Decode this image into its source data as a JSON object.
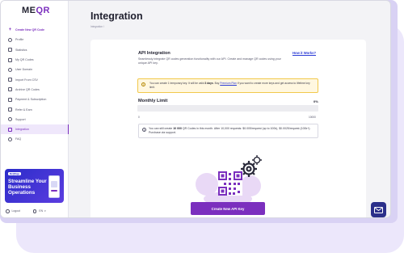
{
  "app": {
    "logo_text_a": "ME",
    "logo_text_b": "QR"
  },
  "sidebar": {
    "items": [
      {
        "label": "Create New QR Code",
        "icon": "plus-icon"
      },
      {
        "label": "Profile",
        "icon": "user-icon"
      },
      {
        "label": "Statistics",
        "icon": "chart-icon"
      },
      {
        "label": "My QR Codes",
        "icon": "qr-icon"
      },
      {
        "label": "User Domain",
        "icon": "globe-icon"
      },
      {
        "label": "Import From CSV",
        "icon": "upload-icon"
      },
      {
        "label": "Archive QR Codes",
        "icon": "archive-icon"
      },
      {
        "label": "Payment & Subscription",
        "icon": "card-icon"
      },
      {
        "label": "Refer & Earn",
        "icon": "gift-icon"
      },
      {
        "label": "Support",
        "icon": "headset-icon"
      },
      {
        "label": "Integration",
        "icon": "link-icon"
      },
      {
        "label": "FAQ",
        "icon": "help-icon"
      }
    ],
    "active": "Integration",
    "promo": {
      "badge": "MeQRapp",
      "text": "Streamline Your Business Operations"
    },
    "footer": {
      "logout": "Logout",
      "language": "EN"
    }
  },
  "page": {
    "title": "Integration",
    "breadcrumb": "Integration /"
  },
  "api": {
    "title": "API Integration",
    "how_link": "How it Works?",
    "description": "Seamlessly integrate QR codes generation functionality with our API. Create and manage QR codes using your unique API key."
  },
  "notice": {
    "prefix": "You can create 1 temporary key. It will be valid ",
    "days": "3 days",
    "middle": ". Buy ",
    "plan_link": "Premium Plan",
    "suffix": " if you want to create more keys and get access to lifetime key limit."
  },
  "limit": {
    "title": "Monthly Limit",
    "percent_label": "0%",
    "percent": 0,
    "min": "0",
    "max": "10000"
  },
  "info": {
    "prefix": "You can still create ",
    "count": "10 000",
    "suffix": " QR Codes in this month. After 10,000 requests: $0.005/request (up to 100k), $0.0025/request (100k+). Purchase via support."
  },
  "actions": {
    "create_key": "Create New API Key"
  },
  "colors": {
    "accent": "#7b2fbe",
    "link": "#2b3bd6",
    "notice_bg": "#fff7e0",
    "mail_button": "#2b2f8a"
  }
}
